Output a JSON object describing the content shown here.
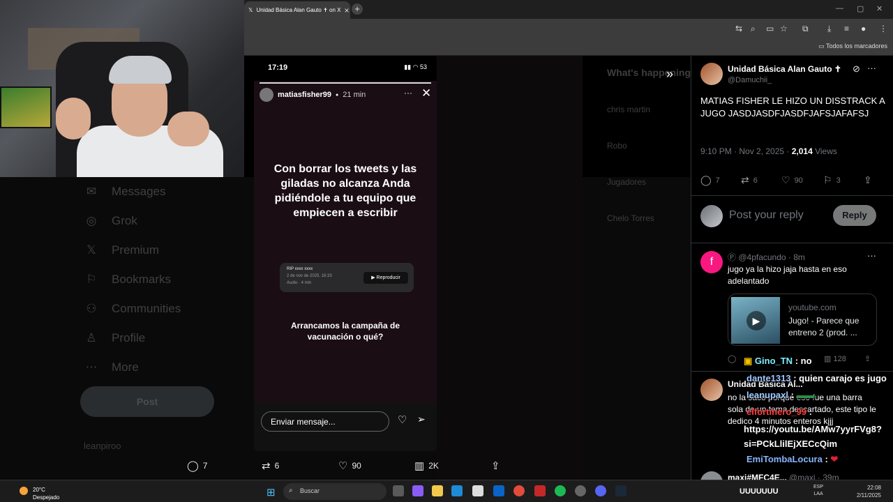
{
  "browser": {
    "tab_title": "Unidad Básica Alan Gauto ✝ on X",
    "bookmarks_label": "Todos los marcadores"
  },
  "background_nav": {
    "items": [
      {
        "icon": "mail-icon",
        "label": "Messages"
      },
      {
        "icon": "grok-icon",
        "label": "Grok"
      },
      {
        "icon": "x-logo-icon",
        "label": "Premium"
      },
      {
        "icon": "bookmark-icon",
        "label": "Bookmarks"
      },
      {
        "icon": "communities-icon",
        "label": "Communities"
      },
      {
        "icon": "profile-icon",
        "label": "Profile"
      },
      {
        "icon": "more-icon",
        "label": "More"
      }
    ],
    "post_label": "Post",
    "profile_name": "leanpiroo"
  },
  "background_trends": {
    "heading": "What's happening",
    "items": [
      "chris martin",
      "Robo",
      "Jugadores",
      "Chelo Torres"
    ]
  },
  "story": {
    "status_time": "17:19",
    "battery": "53",
    "username": "matiasfisher99",
    "time_ago": "21 min",
    "text_main": "Con borrar los tweets y las giladas no alcanza Anda pidiéndole a tu equipo que empiecen a escribir",
    "audio_title": "RIP xxxx xxxx",
    "audio_date": "2 de nov de 2025, 16:33",
    "audio_duration": "Audio · 4 min",
    "play_label": "Reproducir",
    "text_secondary": "Arrancamos la campaña de vacunación o qué?",
    "message_placeholder": "Enviar mensaje..."
  },
  "bottom_actions": {
    "replies": "7",
    "reposts": "6",
    "likes": "90",
    "views": "2K"
  },
  "tweet": {
    "name": "Unidad Básica Alan Gauto ✝",
    "handle": "@Damuchii_",
    "text": "MATIAS FISHER LE HIZO UN DISSTRACK A JUGO JASDJASDFJASDFJAFSJAFAFSJ",
    "time": "9:10 PM · Nov 2, 2025 · ",
    "views_count": "2,014",
    "views_label": " Views",
    "replies": "7",
    "reposts": "6",
    "likes": "90",
    "bookmarks": "3",
    "reply_placeholder": "Post your reply",
    "reply_button": "Reply"
  },
  "replies": [
    {
      "avatar_letter": "f",
      "handle": "@4pfacundo · 8m",
      "text": "jugo ya la hizo jaja hasta en eso adelantado",
      "card_domain": "youtube.com",
      "card_title": "Jugo! - Parece que entreno 2 (prod. ...",
      "views": "128"
    },
    {
      "name": "Unidad Básica Al...",
      "text": "no la saco porque eso fue una barra sola de un tema descartado, este tipo le dedico 4 minutos enteros kjjj"
    },
    {
      "name": "maxi#MFC4E...",
      "handle_time": "@maxi · 39m"
    }
  ],
  "chat": [
    {
      "user": "Gino_TN",
      "msg": "no",
      "color": "#7ef0ff"
    },
    {
      "user": "dante1313",
      "msg": "quien carajo es jugo",
      "color": "#a0c8ff"
    },
    {
      "user": "leanupaxl",
      "msg": "",
      "color": "#a0c8ff"
    },
    {
      "user": "elfortinero_99",
      "msg": "",
      "color": "#ff4040"
    },
    {
      "user": "",
      "msg": "https://youtu.be/AMw7yyrFVg8?si=PCkLlilEjXECcQim",
      "color": "#ffffff"
    },
    {
      "user": "EmiTombaLocura",
      "msg": "",
      "color": "#8ab4ff"
    },
    {
      "user": "",
      "msg": "UUUUUUU",
      "color": "#ffffff"
    }
  ],
  "taskbar": {
    "temp": "20°C",
    "weather": "Despejado",
    "search_placeholder": "Buscar",
    "lang1": "ESP",
    "lang2": "LAA",
    "clock_time": "22:08",
    "clock_date": "2/11/2025"
  }
}
